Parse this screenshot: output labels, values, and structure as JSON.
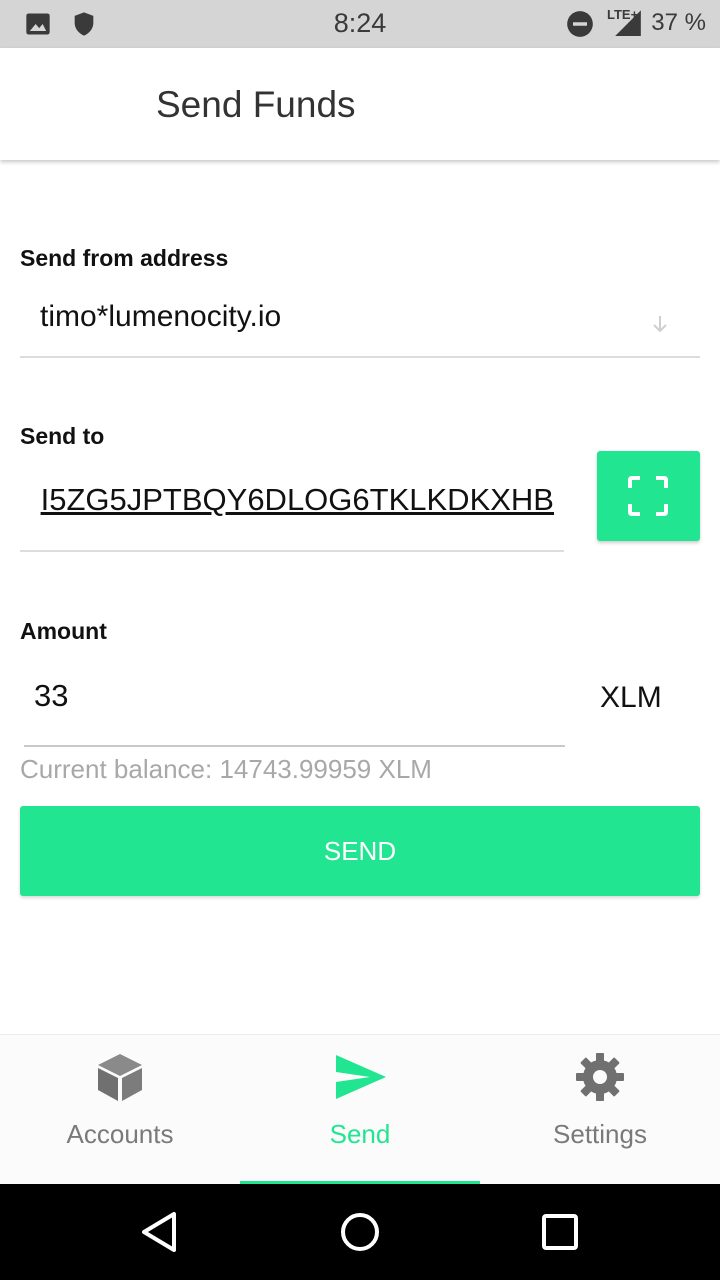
{
  "status_bar": {
    "time": "8:24",
    "network": "LTE+",
    "battery": "37 %",
    "icons": [
      "image-icon",
      "shield-icon",
      "do-not-disturb-icon",
      "signal-icon"
    ]
  },
  "header": {
    "title": "Send Funds"
  },
  "send_from": {
    "label": "Send from address",
    "value": "timo*lumenocity.io",
    "icon": "arrow-down-icon"
  },
  "send_to": {
    "label": "Send to",
    "value": "I5ZG5JPTBQY6DLOG6TKLKDKXHB",
    "scan_icon": "scan-qr-icon"
  },
  "amount": {
    "label": "Amount",
    "value": "33",
    "currency": "XLM",
    "balance_text": "Current balance: 14743.99959 XLM"
  },
  "send_button": {
    "label": "SEND"
  },
  "bottom_nav": {
    "items": [
      {
        "label": "Accounts",
        "icon": "cube-icon",
        "active": false
      },
      {
        "label": "Send",
        "icon": "send-icon",
        "active": true
      },
      {
        "label": "Settings",
        "icon": "gear-icon",
        "active": false
      }
    ]
  },
  "colors": {
    "accent": "#22e592",
    "status_bar_bg": "#d5d5d5",
    "inactive_nav": "#7a7a7a",
    "system_nav_bg": "#000000"
  }
}
